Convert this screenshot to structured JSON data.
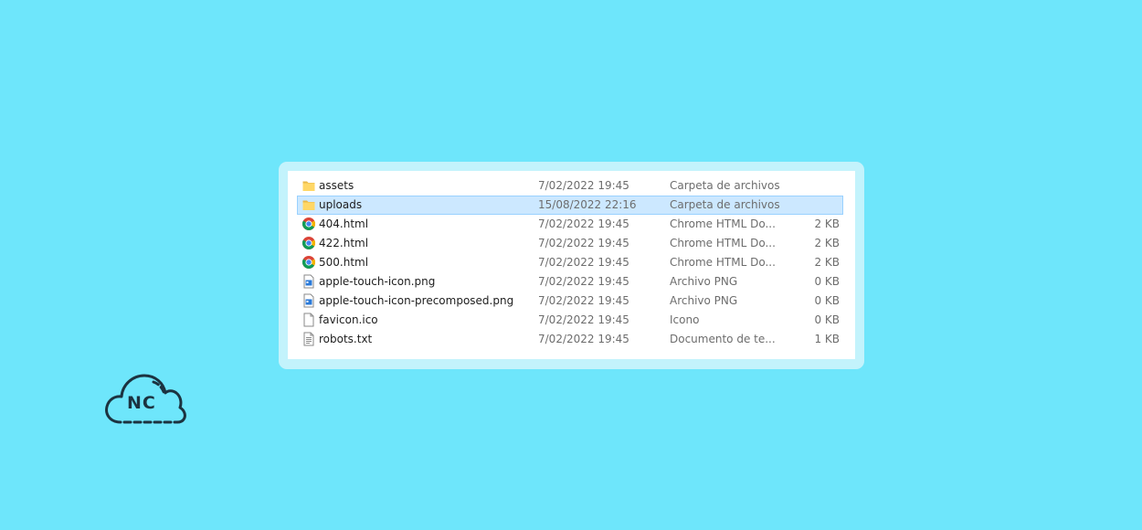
{
  "files": [
    {
      "icon": "folder-icon",
      "name": "assets",
      "date": "7/02/2022 19:45",
      "type": "Carpeta de archivos",
      "size": "",
      "selected": false
    },
    {
      "icon": "folder-icon",
      "name": "uploads",
      "date": "15/08/2022 22:16",
      "type": "Carpeta de archivos",
      "size": "",
      "selected": true
    },
    {
      "icon": "chrome-icon",
      "name": "404.html",
      "date": "7/02/2022 19:45",
      "type": "Chrome HTML Do...",
      "size": "2 KB",
      "selected": false
    },
    {
      "icon": "chrome-icon",
      "name": "422.html",
      "date": "7/02/2022 19:45",
      "type": "Chrome HTML Do...",
      "size": "2 KB",
      "selected": false
    },
    {
      "icon": "chrome-icon",
      "name": "500.html",
      "date": "7/02/2022 19:45",
      "type": "Chrome HTML Do...",
      "size": "2 KB",
      "selected": false
    },
    {
      "icon": "image-file-icon",
      "name": "apple-touch-icon.png",
      "date": "7/02/2022 19:45",
      "type": "Archivo PNG",
      "size": "0 KB",
      "selected": false
    },
    {
      "icon": "image-file-icon",
      "name": "apple-touch-icon-precomposed.png",
      "date": "7/02/2022 19:45",
      "type": "Archivo PNG",
      "size": "0 KB",
      "selected": false
    },
    {
      "icon": "blank-file-icon",
      "name": "favicon.ico",
      "date": "7/02/2022 19:45",
      "type": "Icono",
      "size": "0 KB",
      "selected": false
    },
    {
      "icon": "text-file-icon",
      "name": "robots.txt",
      "date": "7/02/2022 19:45",
      "type": "Documento de te...",
      "size": "1 KB",
      "selected": false
    }
  ],
  "logo": {
    "text": "NC",
    "icon": "cloud-icon"
  },
  "colors": {
    "background": "#6ee6fb",
    "selection": "#cce8ff",
    "folder": "#ffd766",
    "logo_stroke": "#1c3340"
  }
}
